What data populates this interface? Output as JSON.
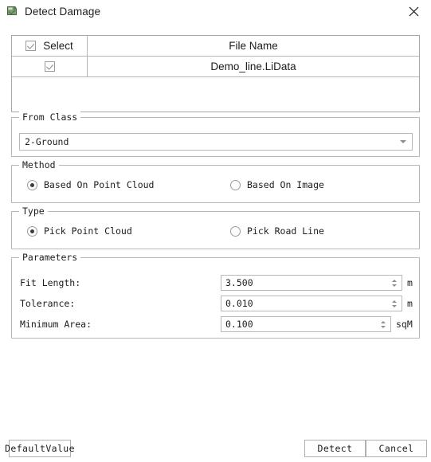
{
  "window": {
    "title": "Detect Damage",
    "icon": "app-logo-icon",
    "close_icon": "close-icon"
  },
  "file_table": {
    "columns": [
      "Select",
      "File Name"
    ],
    "header_checkbox_checked": true,
    "rows": [
      {
        "selected": true,
        "file_name": "Demo_line.LiData"
      }
    ]
  },
  "from_class": {
    "group_label": "From Class",
    "selected": "2-Ground",
    "options": [
      "2-Ground"
    ]
  },
  "method": {
    "group_label": "Method",
    "options": [
      {
        "label": "Based On Point Cloud",
        "selected": true
      },
      {
        "label": "Based On Image",
        "selected": false
      }
    ]
  },
  "type": {
    "group_label": "Type",
    "options": [
      {
        "label": "Pick Point Cloud",
        "selected": true
      },
      {
        "label": "Pick Road Line",
        "selected": false
      }
    ]
  },
  "parameters": {
    "group_label": "Parameters",
    "fields": [
      {
        "label": "Fit Length:",
        "value": "3.500",
        "unit": "m"
      },
      {
        "label": "Tolerance:",
        "value": "0.010",
        "unit": "m"
      },
      {
        "label": "Minimum Area:",
        "value": "0.100",
        "unit": "sqM"
      }
    ]
  },
  "footer": {
    "default_value_label": "DefaultValue",
    "detect_label": "Detect",
    "cancel_label": "Cancel"
  },
  "colors": {
    "dialog_background": "#ffffff",
    "border": "#b9b9b9",
    "table_border": "#a6a6a6",
    "text": "#1d1d1d",
    "control_accent": "#3b3b3b"
  }
}
